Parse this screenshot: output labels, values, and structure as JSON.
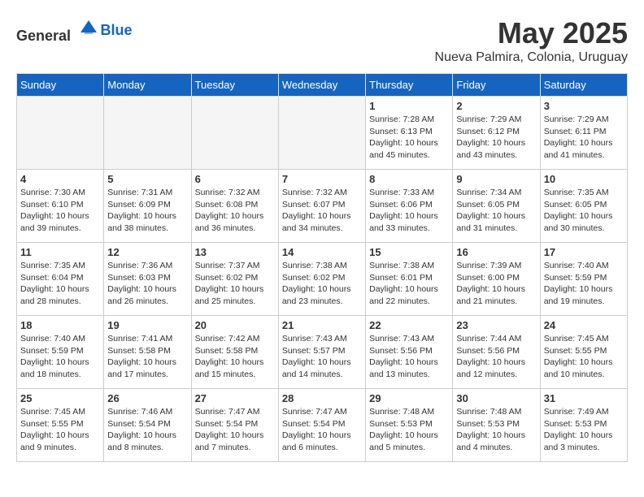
{
  "logo": {
    "general": "General",
    "blue": "Blue"
  },
  "header": {
    "month": "May 2025",
    "location": "Nueva Palmira, Colonia, Uruguay"
  },
  "weekdays": [
    "Sunday",
    "Monday",
    "Tuesday",
    "Wednesday",
    "Thursday",
    "Friday",
    "Saturday"
  ],
  "weeks": [
    [
      {
        "day": "",
        "info": ""
      },
      {
        "day": "",
        "info": ""
      },
      {
        "day": "",
        "info": ""
      },
      {
        "day": "",
        "info": ""
      },
      {
        "day": "1",
        "info": "Sunrise: 7:28 AM\nSunset: 6:13 PM\nDaylight: 10 hours\nand 45 minutes."
      },
      {
        "day": "2",
        "info": "Sunrise: 7:29 AM\nSunset: 6:12 PM\nDaylight: 10 hours\nand 43 minutes."
      },
      {
        "day": "3",
        "info": "Sunrise: 7:29 AM\nSunset: 6:11 PM\nDaylight: 10 hours\nand 41 minutes."
      }
    ],
    [
      {
        "day": "4",
        "info": "Sunrise: 7:30 AM\nSunset: 6:10 PM\nDaylight: 10 hours\nand 39 minutes."
      },
      {
        "day": "5",
        "info": "Sunrise: 7:31 AM\nSunset: 6:09 PM\nDaylight: 10 hours\nand 38 minutes."
      },
      {
        "day": "6",
        "info": "Sunrise: 7:32 AM\nSunset: 6:08 PM\nDaylight: 10 hours\nand 36 minutes."
      },
      {
        "day": "7",
        "info": "Sunrise: 7:32 AM\nSunset: 6:07 PM\nDaylight: 10 hours\nand 34 minutes."
      },
      {
        "day": "8",
        "info": "Sunrise: 7:33 AM\nSunset: 6:06 PM\nDaylight: 10 hours\nand 33 minutes."
      },
      {
        "day": "9",
        "info": "Sunrise: 7:34 AM\nSunset: 6:05 PM\nDaylight: 10 hours\nand 31 minutes."
      },
      {
        "day": "10",
        "info": "Sunrise: 7:35 AM\nSunset: 6:05 PM\nDaylight: 10 hours\nand 30 minutes."
      }
    ],
    [
      {
        "day": "11",
        "info": "Sunrise: 7:35 AM\nSunset: 6:04 PM\nDaylight: 10 hours\nand 28 minutes."
      },
      {
        "day": "12",
        "info": "Sunrise: 7:36 AM\nSunset: 6:03 PM\nDaylight: 10 hours\nand 26 minutes."
      },
      {
        "day": "13",
        "info": "Sunrise: 7:37 AM\nSunset: 6:02 PM\nDaylight: 10 hours\nand 25 minutes."
      },
      {
        "day": "14",
        "info": "Sunrise: 7:38 AM\nSunset: 6:02 PM\nDaylight: 10 hours\nand 23 minutes."
      },
      {
        "day": "15",
        "info": "Sunrise: 7:38 AM\nSunset: 6:01 PM\nDaylight: 10 hours\nand 22 minutes."
      },
      {
        "day": "16",
        "info": "Sunrise: 7:39 AM\nSunset: 6:00 PM\nDaylight: 10 hours\nand 21 minutes."
      },
      {
        "day": "17",
        "info": "Sunrise: 7:40 AM\nSunset: 5:59 PM\nDaylight: 10 hours\nand 19 minutes."
      }
    ],
    [
      {
        "day": "18",
        "info": "Sunrise: 7:40 AM\nSunset: 5:59 PM\nDaylight: 10 hours\nand 18 minutes."
      },
      {
        "day": "19",
        "info": "Sunrise: 7:41 AM\nSunset: 5:58 PM\nDaylight: 10 hours\nand 17 minutes."
      },
      {
        "day": "20",
        "info": "Sunrise: 7:42 AM\nSunset: 5:58 PM\nDaylight: 10 hours\nand 15 minutes."
      },
      {
        "day": "21",
        "info": "Sunrise: 7:43 AM\nSunset: 5:57 PM\nDaylight: 10 hours\nand 14 minutes."
      },
      {
        "day": "22",
        "info": "Sunrise: 7:43 AM\nSunset: 5:56 PM\nDaylight: 10 hours\nand 13 minutes."
      },
      {
        "day": "23",
        "info": "Sunrise: 7:44 AM\nSunset: 5:56 PM\nDaylight: 10 hours\nand 12 minutes."
      },
      {
        "day": "24",
        "info": "Sunrise: 7:45 AM\nSunset: 5:55 PM\nDaylight: 10 hours\nand 10 minutes."
      }
    ],
    [
      {
        "day": "25",
        "info": "Sunrise: 7:45 AM\nSunset: 5:55 PM\nDaylight: 10 hours\nand 9 minutes."
      },
      {
        "day": "26",
        "info": "Sunrise: 7:46 AM\nSunset: 5:54 PM\nDaylight: 10 hours\nand 8 minutes."
      },
      {
        "day": "27",
        "info": "Sunrise: 7:47 AM\nSunset: 5:54 PM\nDaylight: 10 hours\nand 7 minutes."
      },
      {
        "day": "28",
        "info": "Sunrise: 7:47 AM\nSunset: 5:54 PM\nDaylight: 10 hours\nand 6 minutes."
      },
      {
        "day": "29",
        "info": "Sunrise: 7:48 AM\nSunset: 5:53 PM\nDaylight: 10 hours\nand 5 minutes."
      },
      {
        "day": "30",
        "info": "Sunrise: 7:48 AM\nSunset: 5:53 PM\nDaylight: 10 hours\nand 4 minutes."
      },
      {
        "day": "31",
        "info": "Sunrise: 7:49 AM\nSunset: 5:53 PM\nDaylight: 10 hours\nand 3 minutes."
      }
    ]
  ]
}
